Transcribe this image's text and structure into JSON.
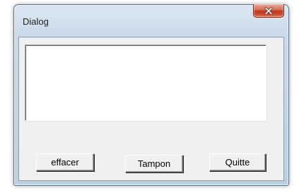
{
  "window": {
    "title": "Dialog",
    "close_icon": "close-x-icon"
  },
  "text_area": {
    "value": ""
  },
  "buttons": {
    "effacer_label": "effacer",
    "tampon_label": "Tampon",
    "quitte_label": "Quitte"
  },
  "colors": {
    "title_bar": "#c9d9ea",
    "close_button": "#c7472a",
    "client_background": "#f0f0f0",
    "text_area_background": "#ffffff"
  }
}
